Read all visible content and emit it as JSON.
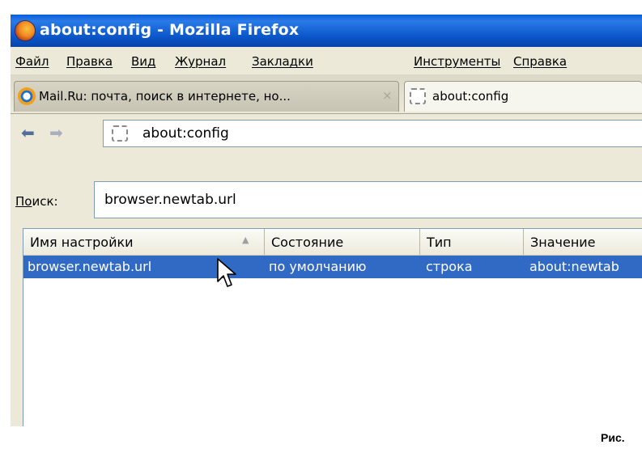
{
  "window": {
    "title": "about:config - Mozilla Firefox"
  },
  "menu": [
    "Файл",
    "Правка",
    "Вид",
    "Журнал",
    "Закладки",
    "Инструменты",
    "Справка"
  ],
  "tabs": [
    {
      "label": "Mail.Ru: почта, поиск в интернете, но...",
      "close": "×",
      "icon": "mail-ru-icon"
    },
    {
      "label": "about:config",
      "icon": "blank-page-icon"
    }
  ],
  "nav": {
    "back": "back-arrow-icon",
    "forward": "forward-arrow-icon",
    "url": "about:config"
  },
  "search": {
    "label": "Поиск:",
    "value": "browser.newtab.url"
  },
  "table": {
    "columns": [
      "Имя настройки",
      "Состояние",
      "Тип",
      "Значение"
    ],
    "rows": [
      {
        "name": "browser.newtab.url",
        "state": "по умолчанию",
        "type": "строка",
        "value": "about:newtab"
      }
    ]
  },
  "caption": "Рис."
}
